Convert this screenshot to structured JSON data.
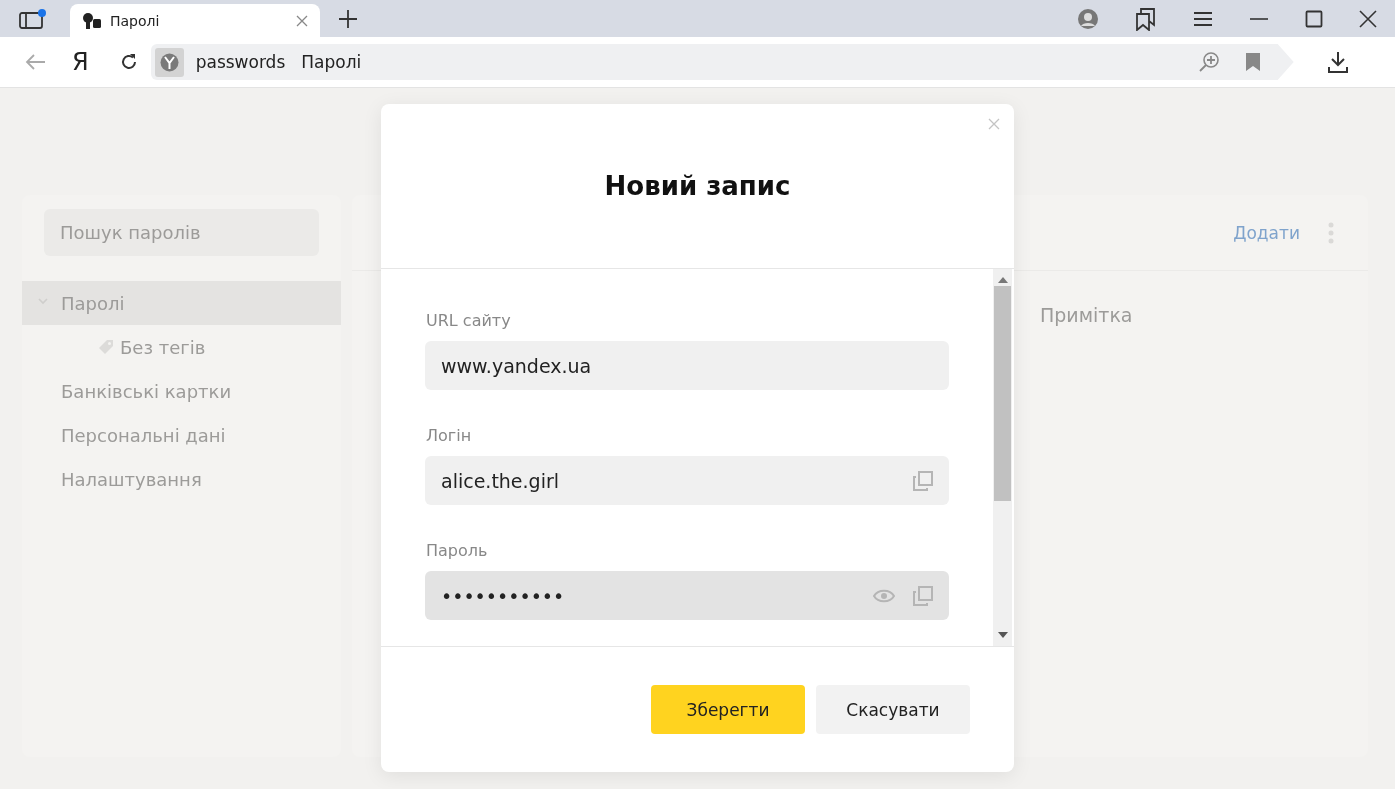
{
  "browser": {
    "tab": {
      "title": "Паролі"
    },
    "logo": "Я",
    "address": {
      "host": "passwords",
      "page_title": "Паролі"
    }
  },
  "sidebar": {
    "search": {
      "placeholder": "Пошук паролів"
    },
    "items": [
      {
        "label": "Паролі",
        "selected": true,
        "expanded": true,
        "children": [
          {
            "label": "Без тегів",
            "selected": false
          }
        ]
      },
      {
        "label": "Банківські картки",
        "selected": false
      },
      {
        "label": "Персональні дані",
        "selected": false
      },
      {
        "label": "Налаштування",
        "selected": false
      }
    ]
  },
  "main": {
    "add_button": "Додати",
    "column_1": "Примітка"
  },
  "dialog": {
    "title": "Новий запис",
    "fields": [
      {
        "kind": "text",
        "label": "URL сайту",
        "value": "www.yandex.ua",
        "focused": false
      },
      {
        "kind": "login",
        "label": "Логін",
        "value": "alice.the.girl",
        "focused": false
      },
      {
        "kind": "password",
        "label": "Пароль",
        "value": "•••••••••••",
        "focused": true
      }
    ],
    "buttons": [
      {
        "kind": "primary",
        "label": "Зберегти"
      },
      {
        "kind": "secondary",
        "label": "Скасувати"
      }
    ]
  }
}
